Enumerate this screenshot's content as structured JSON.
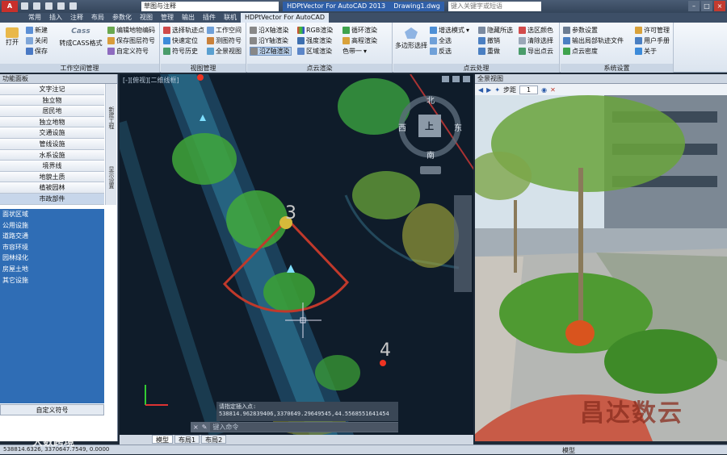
{
  "titlebar": {
    "app_button": "A",
    "workspace": "草图与注释",
    "title": "HDPtVector For AutoCAD 2013",
    "drawing": "Drawing1.dwg",
    "search_placeholder": "键入关键字或短语"
  },
  "menu_tabs": [
    "常用",
    "插入",
    "注释",
    "布局",
    "参数化",
    "视图",
    "管理",
    "输出",
    "插件",
    "联机",
    "HDPtVector For AutoCAD"
  ],
  "ribbon": {
    "workspace_group": {
      "title": "工作空间管理",
      "open": "打开",
      "new": "新建",
      "close": "关闭",
      "save": "保存",
      "cass_logo": "Cass",
      "cass_convert": "转成CASS格式",
      "edit_code": "编辑地物编码",
      "save_symbol": "保存图层符号",
      "custom_symbol": "自定义符号"
    },
    "view_group": {
      "title": "视图管理",
      "select_track": "选择轨迹点",
      "quick_locate": "快速定位",
      "symbol_history": "符号历史",
      "workspace": "工作空间",
      "measure_symbol": "测图符号",
      "panorama": "全景视图"
    },
    "render_group": {
      "title": "点云渲染",
      "x_render": "沿X轴渲染",
      "y_render": "沿Y轴渲染",
      "z_render": "沿Z轴渲染",
      "rgb_render": "RGB渲染",
      "intensity_render": "强度渲染",
      "region_render": "区域渲染",
      "cycle_render": "循环渲染",
      "elevation_render": "高程渲染",
      "color_single": "色带一"
    },
    "pointcloud_group": {
      "title": "点云处理",
      "polygon_select": "多边形选择",
      "add_mode": "增选模式",
      "select_all": "全选",
      "invert": "反选",
      "hide_selected": "隐藏所选",
      "undo": "撤销",
      "redo": "重做",
      "select_color": "选区颜色",
      "clear_select": "清除选择",
      "export_cloud": "导出点云"
    },
    "system_group": {
      "title": "系统设置",
      "params": "参数设置",
      "export_track": "输出局部轨迹文件",
      "cloud_density": "点云密度",
      "license": "许可管理",
      "manual": "用户手册",
      "about": "关于"
    }
  },
  "left_panel": {
    "title": "功能面板",
    "items": [
      "文字注记",
      "独立物",
      "居民地",
      "独立地物",
      "交通设施",
      "管线设施",
      "水系设施",
      "境界线",
      "地貌土质",
      "植被园林",
      "市政部件"
    ],
    "blue_items": [
      "面状区域",
      "公用设施",
      "道路交通",
      "市容环境",
      "园林绿化",
      "房屋土地",
      "其它设施"
    ],
    "side_tabs": [
      "新建工程",
      "显示设置"
    ],
    "custom_symbol": "自定义符号"
  },
  "viewport": {
    "label": "[-][俯视][二维线框]",
    "compass": {
      "north": "北",
      "south": "南",
      "east": "东",
      "west": "西",
      "top": "上"
    },
    "marker_3": "3",
    "marker_4": "4",
    "command_prompt": "请指定插入点:",
    "command_coords": "538814.962839406,3370649.29649545,44.5568551641454",
    "command_input_placeholder": "键入命令"
  },
  "layout_tabs": [
    "模型",
    "布局1",
    "布局2"
  ],
  "panorama": {
    "title": "全景视图",
    "step_label": "步距",
    "step_value": "1",
    "watermark": "昌达数云"
  },
  "statusbar": {
    "coords": "538814.6326, 3370647.7549, 0.0000",
    "model_label": "模型"
  },
  "watermark_left": "大数跨境"
}
